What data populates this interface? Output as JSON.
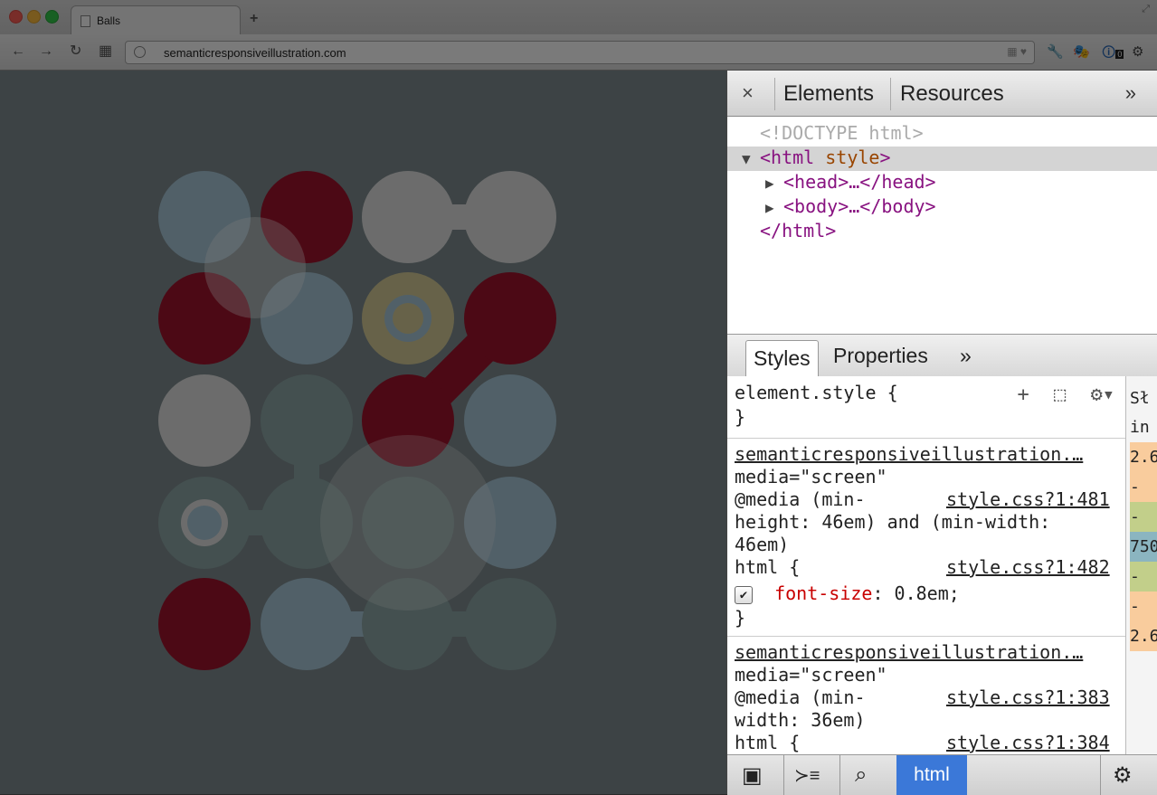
{
  "browser": {
    "tab_title": "Balls",
    "new_tab_label": "+",
    "fullscreen_icon": "⤢",
    "back_icon": "←",
    "forward_icon": "→",
    "reload_icon": "↻",
    "apps_icon": "▦",
    "url": "semanticresponsiveillustration.com",
    "omni_icons": "▦ ♥",
    "wrench_icon": "🔧",
    "ext1_icon": "🎭",
    "ext2_icon": "🛈",
    "ext2_badge": "0",
    "settings_icon": "⚙"
  },
  "illustration": {
    "colors": {
      "blue": "#a9c8d9",
      "red": "#a0132c",
      "light": "#e2e2e2",
      "teal": "#8ea8a7",
      "yellow": "#d8ce9a",
      "background": "#7f8d90"
    }
  },
  "devtools": {
    "close_icon": "×",
    "tabs": [
      "Elements",
      "Resources"
    ],
    "more_icon": "»",
    "dom": {
      "doctype": "<!DOCTYPE html>",
      "html_open_tag": "<html",
      "html_attr": "style",
      "html_open_end": ">",
      "head": "<head>…</head>",
      "body": "<body>…</body>",
      "html_close": "</html>",
      "expand_icon": "▼",
      "collapsed_icon": "▶"
    },
    "styles_tabs": [
      "Styles",
      "Properties"
    ],
    "styles_more_icon": "»",
    "styles_toolbar": {
      "add_icon": "+",
      "inspect_icon": "⬚",
      "gear_icon": "⚙▾"
    },
    "rules": {
      "element_style_open": "element.style {",
      "element_style_close": "}",
      "source_link_1": "semanticresponsiveillustration.…",
      "media_1": "media=\"screen\"",
      "media_query_1a": "@media (min-",
      "media_query_1b": "height: 46em) and (min-width:",
      "media_query_1c": "46em)",
      "file_1a": "style.css?1:481",
      "file_1b": "style.css?1:482",
      "selector_1": "html {",
      "prop_name_1": "font-size",
      "prop_value_1": ": 0.8em;",
      "close_1": "}",
      "source_link_2": "semanticresponsiveillustration.…",
      "media_2": "media=\"screen\"",
      "media_query_2a": "@media (min-",
      "media_query_2b": "width: 36em)",
      "file_2a": "style.css?1:383",
      "file_2b": "style.css?1:384",
      "selector_2": "html {",
      "checkmark": "✔"
    },
    "metrics": {
      "items": [
        "Sł",
        "in",
        "2.6",
        "-",
        "-",
        "750",
        "-",
        "-",
        "2.6"
      ],
      "colors": [
        "#f4f4f4",
        "#f4f4f4",
        "#f9cc9d",
        "#f9cc9d",
        "#c2cf8a",
        "#8bb5c0",
        "#c2cf8a",
        "#f9cc9d",
        "#f9cc9d"
      ]
    },
    "statusbar": {
      "dock_icon": "▣",
      "console_icon": "≻≡",
      "search_icon": "⌕",
      "html_label": "html",
      "settings_icon": "⚙"
    }
  }
}
